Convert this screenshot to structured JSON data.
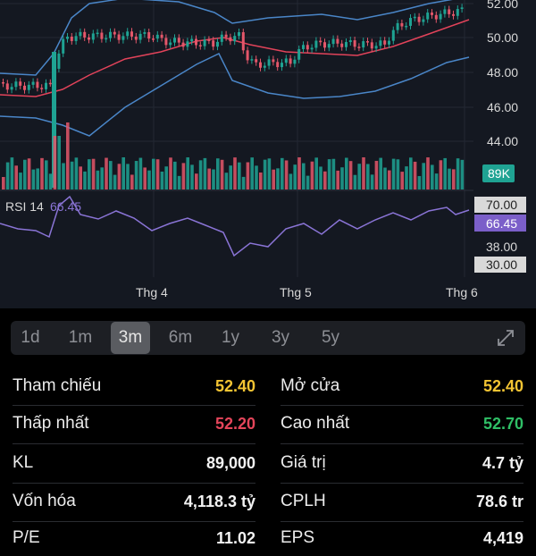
{
  "chart": {
    "price_axis": [
      "52.00",
      "50.00",
      "48.00",
      "46.00",
      "44.00"
    ],
    "volume_badge": "89K",
    "rsi_label": "RSI 14",
    "rsi_value": "66.45",
    "rsi_axis_top": "70.00",
    "rsi_axis_current": "66.45",
    "rsi_axis_mid": "38.00",
    "rsi_axis_bottom": "30.00",
    "months": [
      "Thg 4",
      "Thg 5",
      "Thg 6"
    ],
    "colors": {
      "up": "#1fa393",
      "down": "#e4576a",
      "upper_band": "#4a86c8",
      "middle_band": "#e2435a",
      "rsi_line": "#8a74d6",
      "rsi_badge": "#7b5fc9"
    }
  },
  "timeframes": {
    "options": [
      "1d",
      "1m",
      "3m",
      "6m",
      "1y",
      "3y",
      "5y"
    ],
    "selected": "3m"
  },
  "stats": {
    "reference_label": "Tham chiếu",
    "reference_value": "52.40",
    "open_label": "Mở cửa",
    "open_value": "52.40",
    "low_label": "Thấp nhất",
    "low_value": "52.20",
    "high_label": "Cao nhất",
    "high_value": "52.70",
    "volume_label": "KL",
    "volume_value": "89,000",
    "trade_value_label": "Giá trị",
    "trade_value_value": "4.7 tỷ",
    "market_cap_label": "Vốn hóa",
    "market_cap_value": "4,118.3 tỷ",
    "shares_label": "CPLH",
    "shares_value": "78.6 tr",
    "pe_label": "P/E",
    "pe_value": "11.02",
    "eps_label": "EPS",
    "eps_value": "4,419"
  },
  "value_colors": {
    "reference": "#f3c433",
    "low": "#e4455a",
    "high": "#2fbf66"
  }
}
